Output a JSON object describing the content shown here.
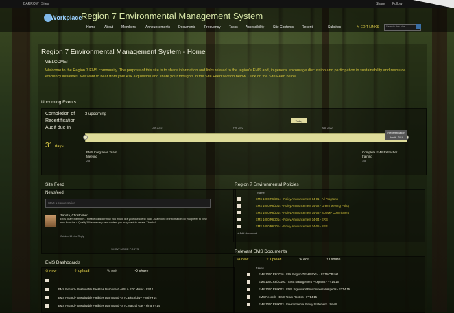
{
  "suite_bar": {
    "left_items": [
      "BARROW",
      "Sites"
    ],
    "right_items": [
      "Share",
      "Follow"
    ]
  },
  "header": {
    "logo_text": "Workplace",
    "site_title": "Region 7 Environmental Management System",
    "nav": [
      "Home",
      "About",
      "Members",
      "Announcements",
      "Documents",
      "Frequency",
      "Tasks",
      "Accessibility",
      "Site Contents",
      "Recent",
      "Subsites"
    ],
    "edit_links_label": "EDIT LINKS",
    "search_placeholder": "Search this site"
  },
  "page": {
    "title": "Region 7 Environmental Management System - Home",
    "welcome_heading": "WELCOME!",
    "welcome_text": "Welcome to the Region 7 EMS community. The purpose of this site is to share information and links related to the region's EMS and, in general encourage discussion and participation in sustainability and resource efficiency initiatives. We want to hear from you! Ask a question and share your thoughts in the Site Feed section below. Click on the Site Feed below."
  },
  "upcoming_events": {
    "heading": "Upcoming Events",
    "side_label": "Completion of Recertification Audit due in",
    "days_value": "31",
    "days_unit": "days",
    "count_label": "3 upcoming",
    "today_label": "Today",
    "end_label": "Recertification Audit - 3/18",
    "ticks": [
      "Jan 2022",
      "Feb 2022",
      "Mar 2022"
    ],
    "events": [
      {
        "title": "EMS Integration Team Meeting",
        "date": "2/8"
      },
      {
        "title": "Complete EMS Refresher training",
        "date": "3/8"
      }
    ]
  },
  "site_feed": {
    "heading": "Site Feed",
    "newsfeed_label": "Newsfeed",
    "conversation_placeholder": "Start a conversation",
    "post": {
      "author": "Zapata, Christopher",
      "text": "EMS Team Members - Please consider how you would like your outside to build - Main kind of information do you prefer to view now from the 4 Quality? We are very new content you may want to create. Thanks!",
      "meta": "October 15    Like    Reply"
    },
    "show_more": "SHOW MORE POSTS"
  },
  "policies": {
    "heading": "Region 7 Environmental Policies",
    "column_header": "Name",
    "items": [
      "EMS 1000.R6/2014 - Policy Announcement 14-01 - All Programs",
      "EMS 1000.R6/2014 - Policy Announcement 14-02 - Green Meeting Policy",
      "EMS 1000.R6/2014 - Policy Announcement 14-03 - SLWMP Commitment",
      "EMS 1000.R6/2014 - Policy Announcement 14-04 - ERBI",
      "EMS 1000.R6/2014 - Policy Announcement 14-05 - SPP"
    ],
    "add_label": "+ Add document"
  },
  "ems_documents": {
    "heading": "Relevant EMS Documents",
    "toolbar": {
      "new": "new",
      "upload": "upload",
      "edit": "edit",
      "share": "share"
    },
    "column_header": "Name",
    "items": [
      "EMS 1000.R6/2016 - EPA Region 7 EMS FY14 - FY15 OP List",
      "EMS 1000.R6/2016C - EMS Management Programs - FY14 15",
      "EMS 1000.R6/0003 - EMS Significant Environmental Aspects - FY14 15",
      "EMS Records - EMS Team Rosters - FY14 15",
      "EMS 1000.R6/0003 - Environmental Policy Statement - Small"
    ]
  },
  "ems_dashboards": {
    "heading": "EMS Dashboards",
    "toolbar": {
      "new": "new",
      "upload": "upload",
      "edit": "edit",
      "share": "share"
    },
    "items": [
      "EMS Record - Sustainable Facilities Dashboard - ASI & STC Water - FY14",
      "EMS Record - Sustainable Facilities Dashboard - STC Electricity - Final FY14",
      "EMS Record - Sustainable Facilities Dashboard - STC Natural Gas - Final FY14"
    ]
  },
  "colors": {
    "accent_yellow": "#e6d44a",
    "timeline_bar": "#dedc9a",
    "title_green": "#d8e6a8"
  }
}
